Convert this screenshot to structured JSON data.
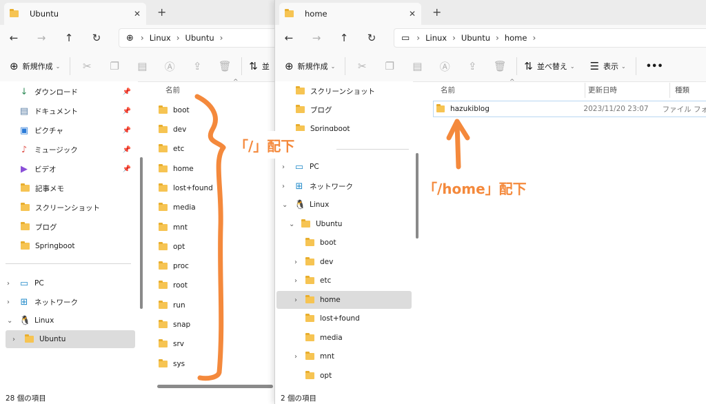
{
  "left_window": {
    "tab_title": "Ubuntu",
    "breadcrumb": [
      "Linux",
      "Ubuntu"
    ],
    "toolbar": {
      "new_label": "新規作成",
      "sort_label": "並"
    },
    "nav_items": [
      {
        "label": "ダウンロード",
        "icon": "download-icon",
        "pinned": true
      },
      {
        "label": "ドキュメント",
        "icon": "document-icon",
        "pinned": true
      },
      {
        "label": "ピクチャ",
        "icon": "pictures-icon",
        "pinned": true
      },
      {
        "label": "ミュージック",
        "icon": "music-icon",
        "pinned": true
      },
      {
        "label": "ビデオ",
        "icon": "video-icon",
        "pinned": true
      },
      {
        "label": "記事メモ",
        "icon": "folder-icon"
      },
      {
        "label": "スクリーンショット",
        "icon": "folder-icon"
      },
      {
        "label": "ブログ",
        "icon": "folder-icon"
      },
      {
        "label": "Springboot",
        "icon": "folder-icon"
      }
    ],
    "tree": [
      {
        "label": "PC",
        "icon": "pc-icon"
      },
      {
        "label": "ネットワーク",
        "icon": "network-icon"
      },
      {
        "label": "Linux",
        "icon": "linux-icon"
      },
      {
        "label": "Ubuntu",
        "icon": "folder-icon",
        "selected": true
      }
    ],
    "column_name": "名前",
    "files": [
      "boot",
      "dev",
      "etc",
      "home",
      "lost+found",
      "media",
      "mnt",
      "opt",
      "proc",
      "root",
      "run",
      "snap",
      "srv",
      "sys"
    ],
    "status": "28 個の項目"
  },
  "right_window": {
    "tab_title": "home",
    "breadcrumb": [
      "Linux",
      "Ubuntu",
      "home"
    ],
    "toolbar": {
      "new_label": "新規作成",
      "sort_label": "並べ替え",
      "view_label": "表示",
      "more": "•••"
    },
    "nav_items": [
      {
        "label": "スクリーンショット"
      },
      {
        "label": "ブログ"
      },
      {
        "label": "Springboot"
      }
    ],
    "tree": [
      {
        "label": "PC",
        "icon": "pc-icon"
      },
      {
        "label": "ネットワーク",
        "icon": "network-icon"
      },
      {
        "label": "Linux",
        "icon": "linux-icon"
      },
      {
        "label": "Ubuntu",
        "icon": "folder-icon"
      },
      {
        "label": "boot"
      },
      {
        "label": "dev"
      },
      {
        "label": "etc"
      },
      {
        "label": "home",
        "selected": true
      },
      {
        "label": "lost+found"
      },
      {
        "label": "media"
      },
      {
        "label": "mnt"
      },
      {
        "label": "opt"
      }
    ],
    "columns": [
      "名前",
      "更新日時",
      "種類"
    ],
    "files": [
      {
        "name": "hazukiblog",
        "modified": "2023/11/20 23:07",
        "type": "ファイル フォ"
      }
    ],
    "status": "2 個の項目"
  },
  "annotations": {
    "root_label": "「/」配下",
    "home_label": "「/home」配下",
    "color": "#f4893c"
  }
}
